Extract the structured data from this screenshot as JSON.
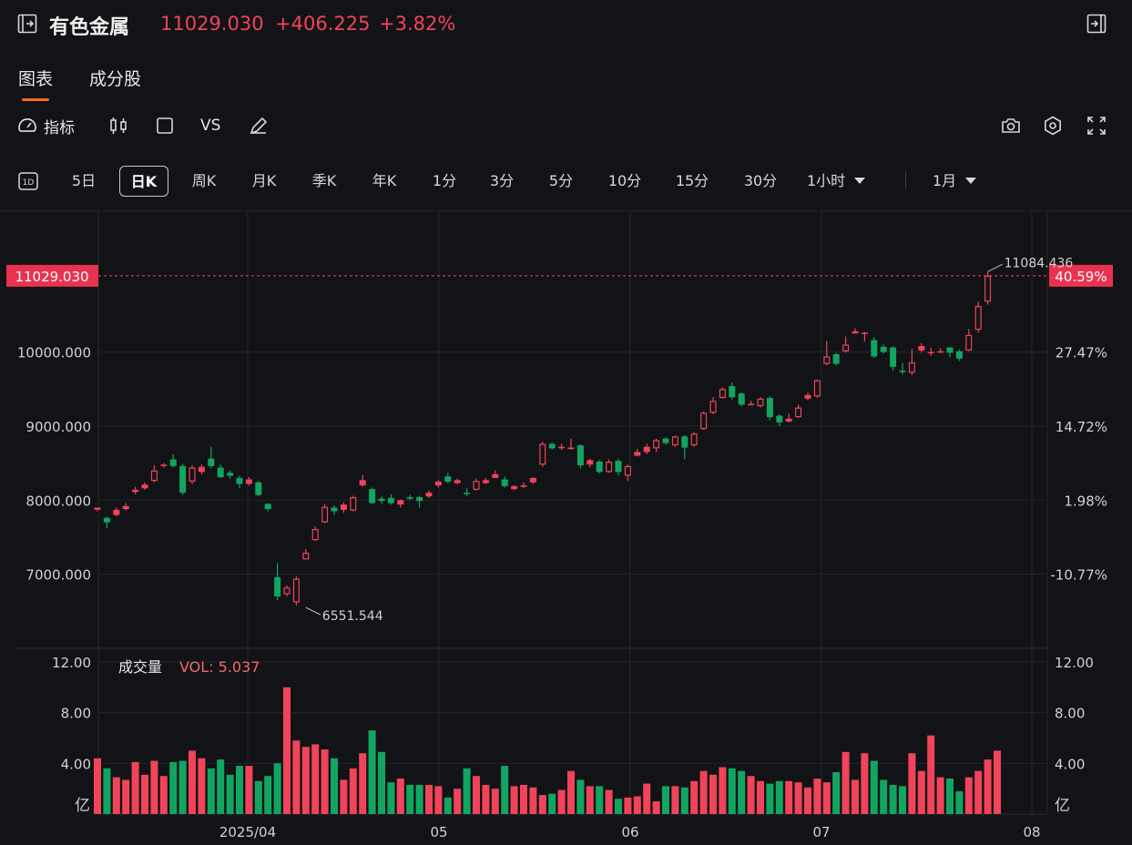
{
  "header": {
    "collapse_icon": "collapse-left-icon",
    "name": "有色金属",
    "price": "11029.030",
    "change": "+406.225",
    "change_pct": "+3.82%",
    "expand_icon": "expand-right-icon"
  },
  "tabs": [
    {
      "label": "图表",
      "active": true
    },
    {
      "label": "成分股",
      "active": false
    }
  ],
  "toolbar": {
    "indicator_label": "指标",
    "vs_label": "VS",
    "icons": [
      "gauge-icon",
      "candlestick-icon",
      "square-icon",
      "pen-icon",
      "camera-icon",
      "gear-icon",
      "fullscreen-icon"
    ]
  },
  "periods": [
    {
      "label": "1D",
      "active": false
    },
    {
      "label": "5日",
      "active": false
    },
    {
      "label": "日K",
      "active": true
    },
    {
      "label": "周K",
      "active": false
    },
    {
      "label": "月K",
      "active": false
    },
    {
      "label": "季K",
      "active": false
    },
    {
      "label": "年K",
      "active": false
    },
    {
      "label": "1分",
      "active": false
    },
    {
      "label": "3分",
      "active": false
    },
    {
      "label": "5分",
      "active": false
    },
    {
      "label": "10分",
      "active": false
    },
    {
      "label": "15分",
      "active": false
    },
    {
      "label": "30分",
      "active": false
    },
    {
      "label": "1小时",
      "active": false
    },
    {
      "label": "1月",
      "active": false
    }
  ],
  "colors": {
    "up": "#f0445a",
    "down": "#12a562",
    "bg": "#121316",
    "grid": "#23252b"
  },
  "chart_data": {
    "type": "candlestick",
    "price_axis": {
      "ticks": [
        7000,
        8000,
        9000,
        10000
      ],
      "tick_labels": [
        "7000.000",
        "8000.000",
        "9000.000",
        "10000.000"
      ],
      "range": [
        6000,
        11900
      ]
    },
    "percent_axis": {
      "tick_labels": [
        "-10.77%",
        "1.98%",
        "14.72%",
        "27.47%"
      ],
      "current_label": "40.59%"
    },
    "current_price": 11029.03,
    "current_price_label": "11029.030",
    "max_label": "11084.436",
    "min_label": "6551.544",
    "x_labels": [
      "2025/04",
      "05",
      "06",
      "07",
      "08"
    ],
    "candles": [
      [
        7870,
        7900,
        7850,
        7880
      ],
      [
        7760,
        7700,
        7620,
        7780
      ],
      [
        7800,
        7870,
        7780,
        7900
      ],
      [
        7880,
        7920,
        7860,
        7960
      ],
      [
        8110,
        8140,
        8080,
        8180
      ],
      [
        8160,
        8210,
        8140,
        8240
      ],
      [
        8260,
        8400,
        8240,
        8470
      ],
      [
        8470,
        8480,
        8440,
        8500
      ],
      [
        8550,
        8460,
        8440,
        8620
      ],
      [
        8460,
        8100,
        8070,
        8490
      ],
      [
        8250,
        8440,
        8220,
        8470
      ],
      [
        8380,
        8450,
        8350,
        8480
      ],
      [
        8560,
        8460,
        8430,
        8720
      ],
      [
        8440,
        8310,
        8300,
        8480
      ],
      [
        8370,
        8330,
        8290,
        8400
      ],
      [
        8300,
        8220,
        8160,
        8330
      ],
      [
        8220,
        8280,
        8200,
        8310
      ],
      [
        8240,
        8070,
        8050,
        8260
      ],
      [
        7950,
        7880,
        7850,
        7960
      ],
      [
        6960,
        6700,
        6650,
        7150
      ],
      [
        6730,
        6820,
        6700,
        6850
      ],
      [
        6620,
        6940,
        6580,
        6970
      ],
      [
        7200,
        7290,
        7200,
        7340
      ],
      [
        7460,
        7610,
        7450,
        7640
      ],
      [
        7700,
        7910,
        7690,
        7950
      ],
      [
        7900,
        7850,
        7800,
        7930
      ],
      [
        7870,
        7940,
        7830,
        7970
      ],
      [
        7860,
        8040,
        7850,
        8060
      ],
      [
        8200,
        8270,
        8180,
        8340
      ],
      [
        8150,
        7960,
        7950,
        8170
      ],
      [
        8020,
        7990,
        7950,
        8050
      ],
      [
        8030,
        7960,
        7940,
        8080
      ],
      [
        7940,
        8000,
        7900,
        8010
      ],
      [
        8040,
        8020,
        8000,
        8070
      ],
      [
        8040,
        7990,
        7900,
        8060
      ],
      [
        8050,
        8100,
        8030,
        8130
      ],
      [
        8200,
        8250,
        8170,
        8270
      ],
      [
        8320,
        8250,
        8230,
        8370
      ],
      [
        8230,
        8270,
        8210,
        8290
      ],
      [
        8100,
        8090,
        8050,
        8160
      ],
      [
        8140,
        8260,
        8130,
        8290
      ],
      [
        8230,
        8270,
        8220,
        8300
      ],
      [
        8300,
        8350,
        8300,
        8400
      ],
      [
        8280,
        8190,
        8170,
        8320
      ],
      [
        8150,
        8190,
        8130,
        8200
      ],
      [
        8180,
        8200,
        8160,
        8240
      ],
      [
        8240,
        8300,
        8220,
        8310
      ],
      [
        8480,
        8760,
        8450,
        8790
      ],
      [
        8760,
        8700,
        8680,
        8780
      ],
      [
        8700,
        8720,
        8680,
        8760
      ],
      [
        8700,
        8710,
        8680,
        8830
      ],
      [
        8740,
        8470,
        8430,
        8750
      ],
      [
        8480,
        8540,
        8440,
        8560
      ],
      [
        8520,
        8380,
        8360,
        8540
      ],
      [
        8380,
        8520,
        8370,
        8550
      ],
      [
        8530,
        8380,
        8330,
        8560
      ],
      [
        8330,
        8460,
        8260,
        8480
      ],
      [
        8600,
        8650,
        8590,
        8690
      ],
      [
        8650,
        8720,
        8620,
        8760
      ],
      [
        8700,
        8810,
        8650,
        8830
      ],
      [
        8830,
        8770,
        8750,
        8850
      ],
      [
        8740,
        8860,
        8720,
        8870
      ],
      [
        8860,
        8710,
        8550,
        8880
      ],
      [
        8740,
        8900,
        8720,
        8920
      ],
      [
        8960,
        9180,
        8950,
        9200
      ],
      [
        9180,
        9340,
        9160,
        9390
      ],
      [
        9380,
        9500,
        9370,
        9520
      ],
      [
        9540,
        9390,
        9360,
        9590
      ],
      [
        9440,
        9290,
        9270,
        9460
      ],
      [
        9300,
        9300,
        9290,
        9340
      ],
      [
        9270,
        9370,
        9250,
        9390
      ],
      [
        9380,
        9120,
        9080,
        9400
      ],
      [
        9140,
        9050,
        9000,
        9160
      ],
      [
        9060,
        9100,
        9050,
        9170
      ],
      [
        9120,
        9250,
        9110,
        9290
      ],
      [
        9370,
        9420,
        9350,
        9450
      ],
      [
        9400,
        9620,
        9380,
        9630
      ],
      [
        9840,
        9940,
        9820,
        10150
      ],
      [
        9970,
        9840,
        9820,
        9990
      ],
      [
        10010,
        10100,
        9990,
        10210
      ],
      [
        10250,
        10280,
        10250,
        10320
      ],
      [
        10260,
        10260,
        10140,
        10270
      ],
      [
        10160,
        9940,
        9920,
        10200
      ],
      [
        10070,
        10000,
        9980,
        10100
      ],
      [
        10060,
        9800,
        9750,
        10080
      ],
      [
        9750,
        9730,
        9700,
        9850
      ],
      [
        9720,
        9860,
        9690,
        10040
      ],
      [
        10020,
        10080,
        9990,
        10120
      ],
      [
        10000,
        10000,
        9950,
        10060
      ],
      [
        10000,
        10010,
        9990,
        10050
      ],
      [
        10060,
        9990,
        9930,
        10070
      ],
      [
        10010,
        9910,
        9880,
        10030
      ],
      [
        10020,
        10230,
        10010,
        10310
      ],
      [
        10300,
        10620,
        10260,
        10680
      ],
      [
        10680,
        11029.03,
        10640,
        11084.436
      ]
    ],
    "volume": {
      "title": "成交量",
      "label": "VOL: 5.037",
      "axis_labels": [
        "12.00",
        "8.00",
        "4.00"
      ],
      "unit_label": "亿",
      "range": [
        0,
        12.5
      ],
      "values": [
        4.4,
        3.6,
        2.9,
        2.7,
        4.1,
        3.1,
        4.2,
        3.0,
        4.1,
        4.2,
        5.0,
        4.4,
        3.6,
        4.3,
        3.1,
        3.8,
        3.8,
        2.6,
        3.0,
        4.0,
        10.0,
        5.8,
        5.3,
        5.5,
        5.1,
        4.4,
        2.7,
        3.6,
        4.8,
        6.6,
        4.9,
        2.5,
        2.8,
        2.3,
        2.3,
        2.3,
        2.2,
        1.3,
        2.0,
        3.6,
        3.0,
        2.3,
        2.0,
        3.8,
        2.2,
        2.3,
        2.1,
        1.5,
        1.6,
        1.9,
        3.4,
        2.7,
        2.2,
        2.2,
        1.9,
        1.2,
        1.3,
        1.4,
        2.4,
        1.0,
        2.2,
        2.2,
        2.1,
        2.6,
        3.4,
        3.1,
        3.7,
        3.6,
        3.4,
        3.0,
        2.6,
        2.4,
        2.6,
        2.6,
        2.5,
        2.1,
        2.8,
        2.5,
        3.3,
        4.9,
        2.7,
        4.8,
        4.2,
        2.7,
        2.3,
        2.2,
        4.8,
        3.4,
        6.2,
        2.9,
        2.8,
        1.8,
        2.9,
        3.4,
        4.3,
        5.0
      ]
    }
  }
}
